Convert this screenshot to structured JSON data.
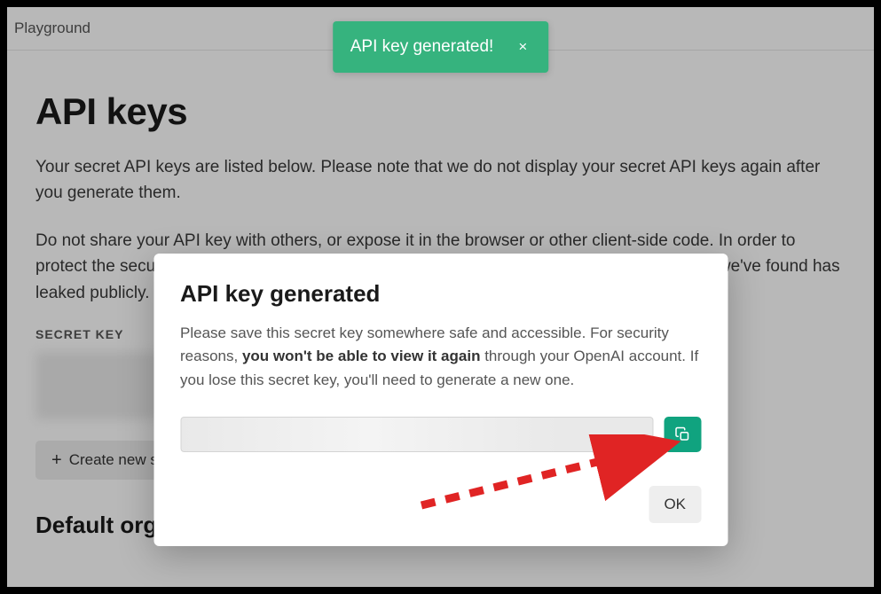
{
  "header": {
    "nav_label": "Playground"
  },
  "page": {
    "title": "API keys",
    "description_1": "Your secret API keys are listed below. Please note that we do not display your secret API keys again after you generate them.",
    "description_2": "Do not share your API key with others, or expose it in the browser or other client-side code. In order to protect the security of your account, OpenAI may also automatically rotate any API key that we've found has leaked publicly.",
    "secret_key_label": "SECRET KEY",
    "create_button_label": "Create new secret key",
    "default_org_title": "Default organization"
  },
  "toast": {
    "message": "API key generated!",
    "close_glyph": "×"
  },
  "modal": {
    "title": "API key generated",
    "desc_part_1": "Please save this secret key somewhere safe and accessible. For security reasons, ",
    "desc_strong": "you won't be able to view it again",
    "desc_part_2": " through your OpenAI account. If you lose this secret key, you'll need to generate a new one.",
    "key_value": "",
    "ok_label": "OK"
  },
  "colors": {
    "accent_green": "#10a37f",
    "toast_green": "#36b37e",
    "annotation_red": "#e02424"
  }
}
